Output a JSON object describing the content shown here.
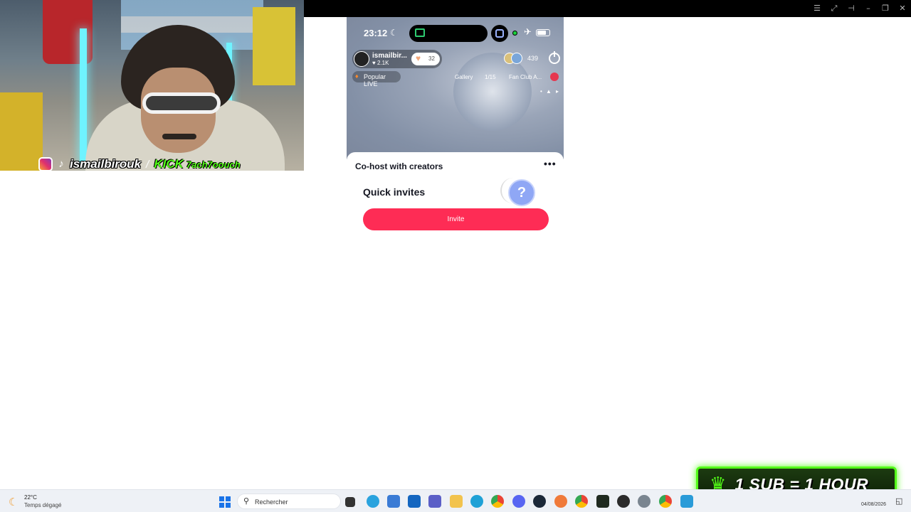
{
  "window": {
    "icons": [
      "list-icon",
      "expand-icon",
      "pin-icon",
      "minimize-icon",
      "restore-icon",
      "close-icon"
    ]
  },
  "stream_overlay": {
    "social_handle": "ismailbirouk",
    "kick_label": "KICK",
    "kick_handle": "7ach7oouch",
    "sub_banner": "1 SUB = 1 HOUR"
  },
  "phone": {
    "status": {
      "time": "23:12"
    },
    "live": {
      "host_name": "ismailbir...",
      "host_likes": "2.1K",
      "like_count": "32",
      "viewer_count": "439",
      "popular_label": "Popular LIVE",
      "gallery_label": "Gallery",
      "gallery_count": "1/15",
      "fan_club_label": "Fan Club A..."
    },
    "sheet": {
      "title": "Co-host with creators",
      "quick_invites_title": "Quick invites",
      "invite_button": "Invite",
      "help_glyph": "?"
    }
  },
  "taskbar": {
    "weather_temp": "22°C",
    "weather_desc": "Temps dégagé",
    "search_placeholder": "Rechercher",
    "date": "04/08/2026",
    "apps": [
      "task-view-icon",
      "telegram-icon",
      "store-icon",
      "outlook-icon",
      "teams-icon",
      "file-explorer-icon",
      "edge-icon",
      "chrome-icon",
      "discord-icon",
      "steam-icon",
      "obs-icon",
      "chrome-profile-icon",
      "terminal-icon",
      "davinci-icon",
      "settings-icon",
      "chrome-alt-icon",
      "phone-link-icon"
    ]
  },
  "colors": {
    "accent": "#fe2c55",
    "kick_green": "#53fc18",
    "help_blue": "#8fa7f5"
  }
}
